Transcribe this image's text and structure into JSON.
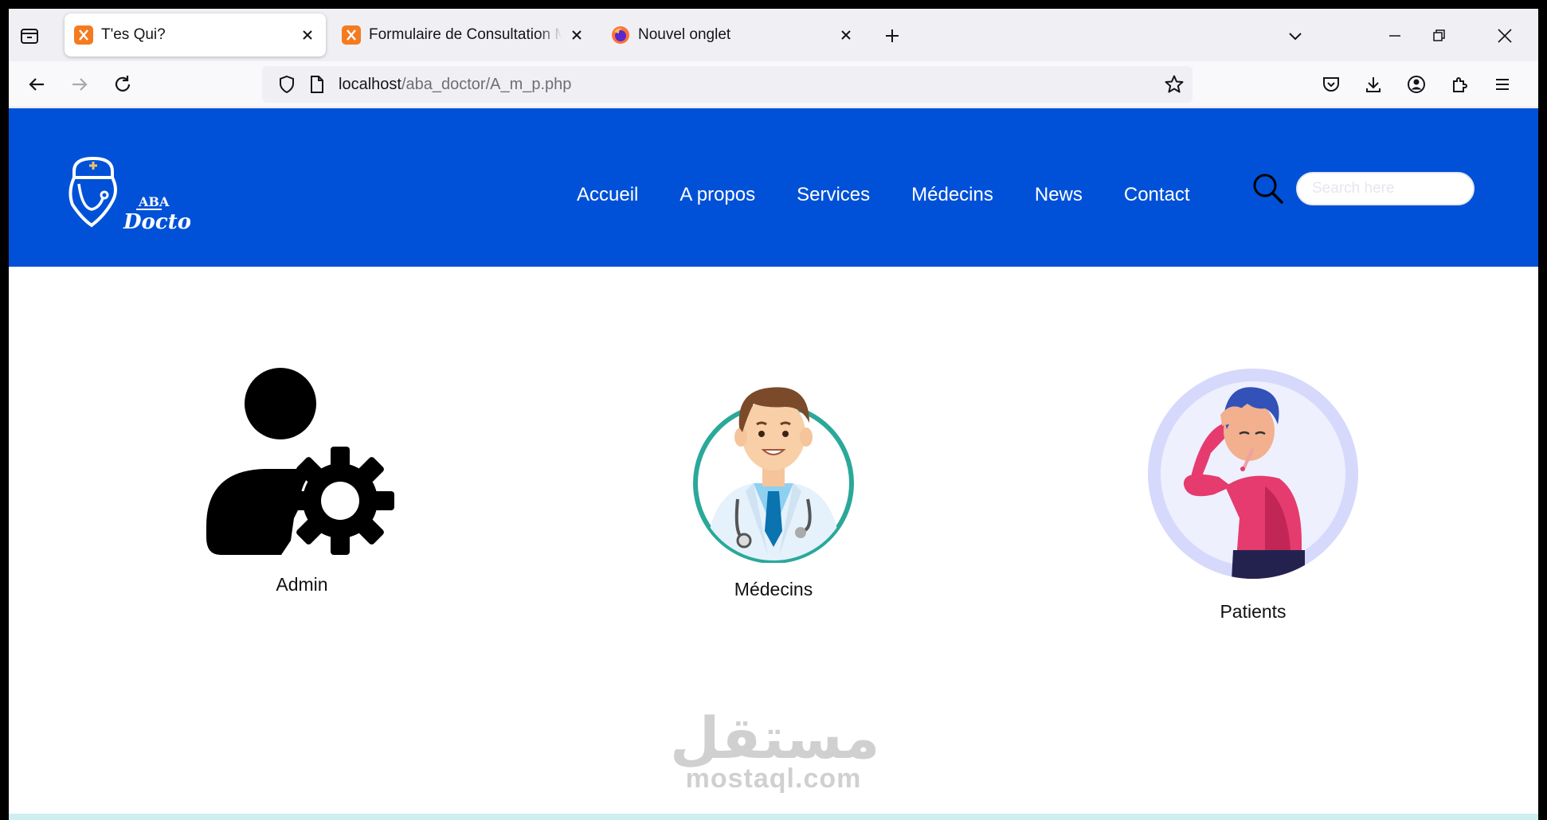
{
  "browser": {
    "tabs": [
      {
        "title": "T'es Qui?",
        "active": true
      },
      {
        "title": "Formulaire de Consultation Mé",
        "active": false
      },
      {
        "title": "Nouvel onglet",
        "active": false
      }
    ],
    "url": {
      "host": "localhost",
      "path": "/aba_doctor/A_m_p.php"
    }
  },
  "site": {
    "logo": {
      "line1": "ABA",
      "line2": "Doctor"
    },
    "menu": [
      "Accueil",
      "A propos",
      "Services",
      "Médecins",
      "News",
      "Contact"
    ],
    "search_placeholder": "Search here"
  },
  "roles": [
    {
      "label": "Admin",
      "icon": "admin-gear-icon"
    },
    {
      "label": "Médecins",
      "icon": "doctor-illustration"
    },
    {
      "label": "Patients",
      "icon": "sick-patient-illustration"
    }
  ],
  "watermark": {
    "arabic": "مستقل",
    "latin": "mostaql.com"
  },
  "colors": {
    "brand_blue": "#0051d8",
    "tab_bg": "#f0f0f4",
    "teal_ring": "#2aa89a",
    "patient_ring": "#d6d9fb"
  }
}
